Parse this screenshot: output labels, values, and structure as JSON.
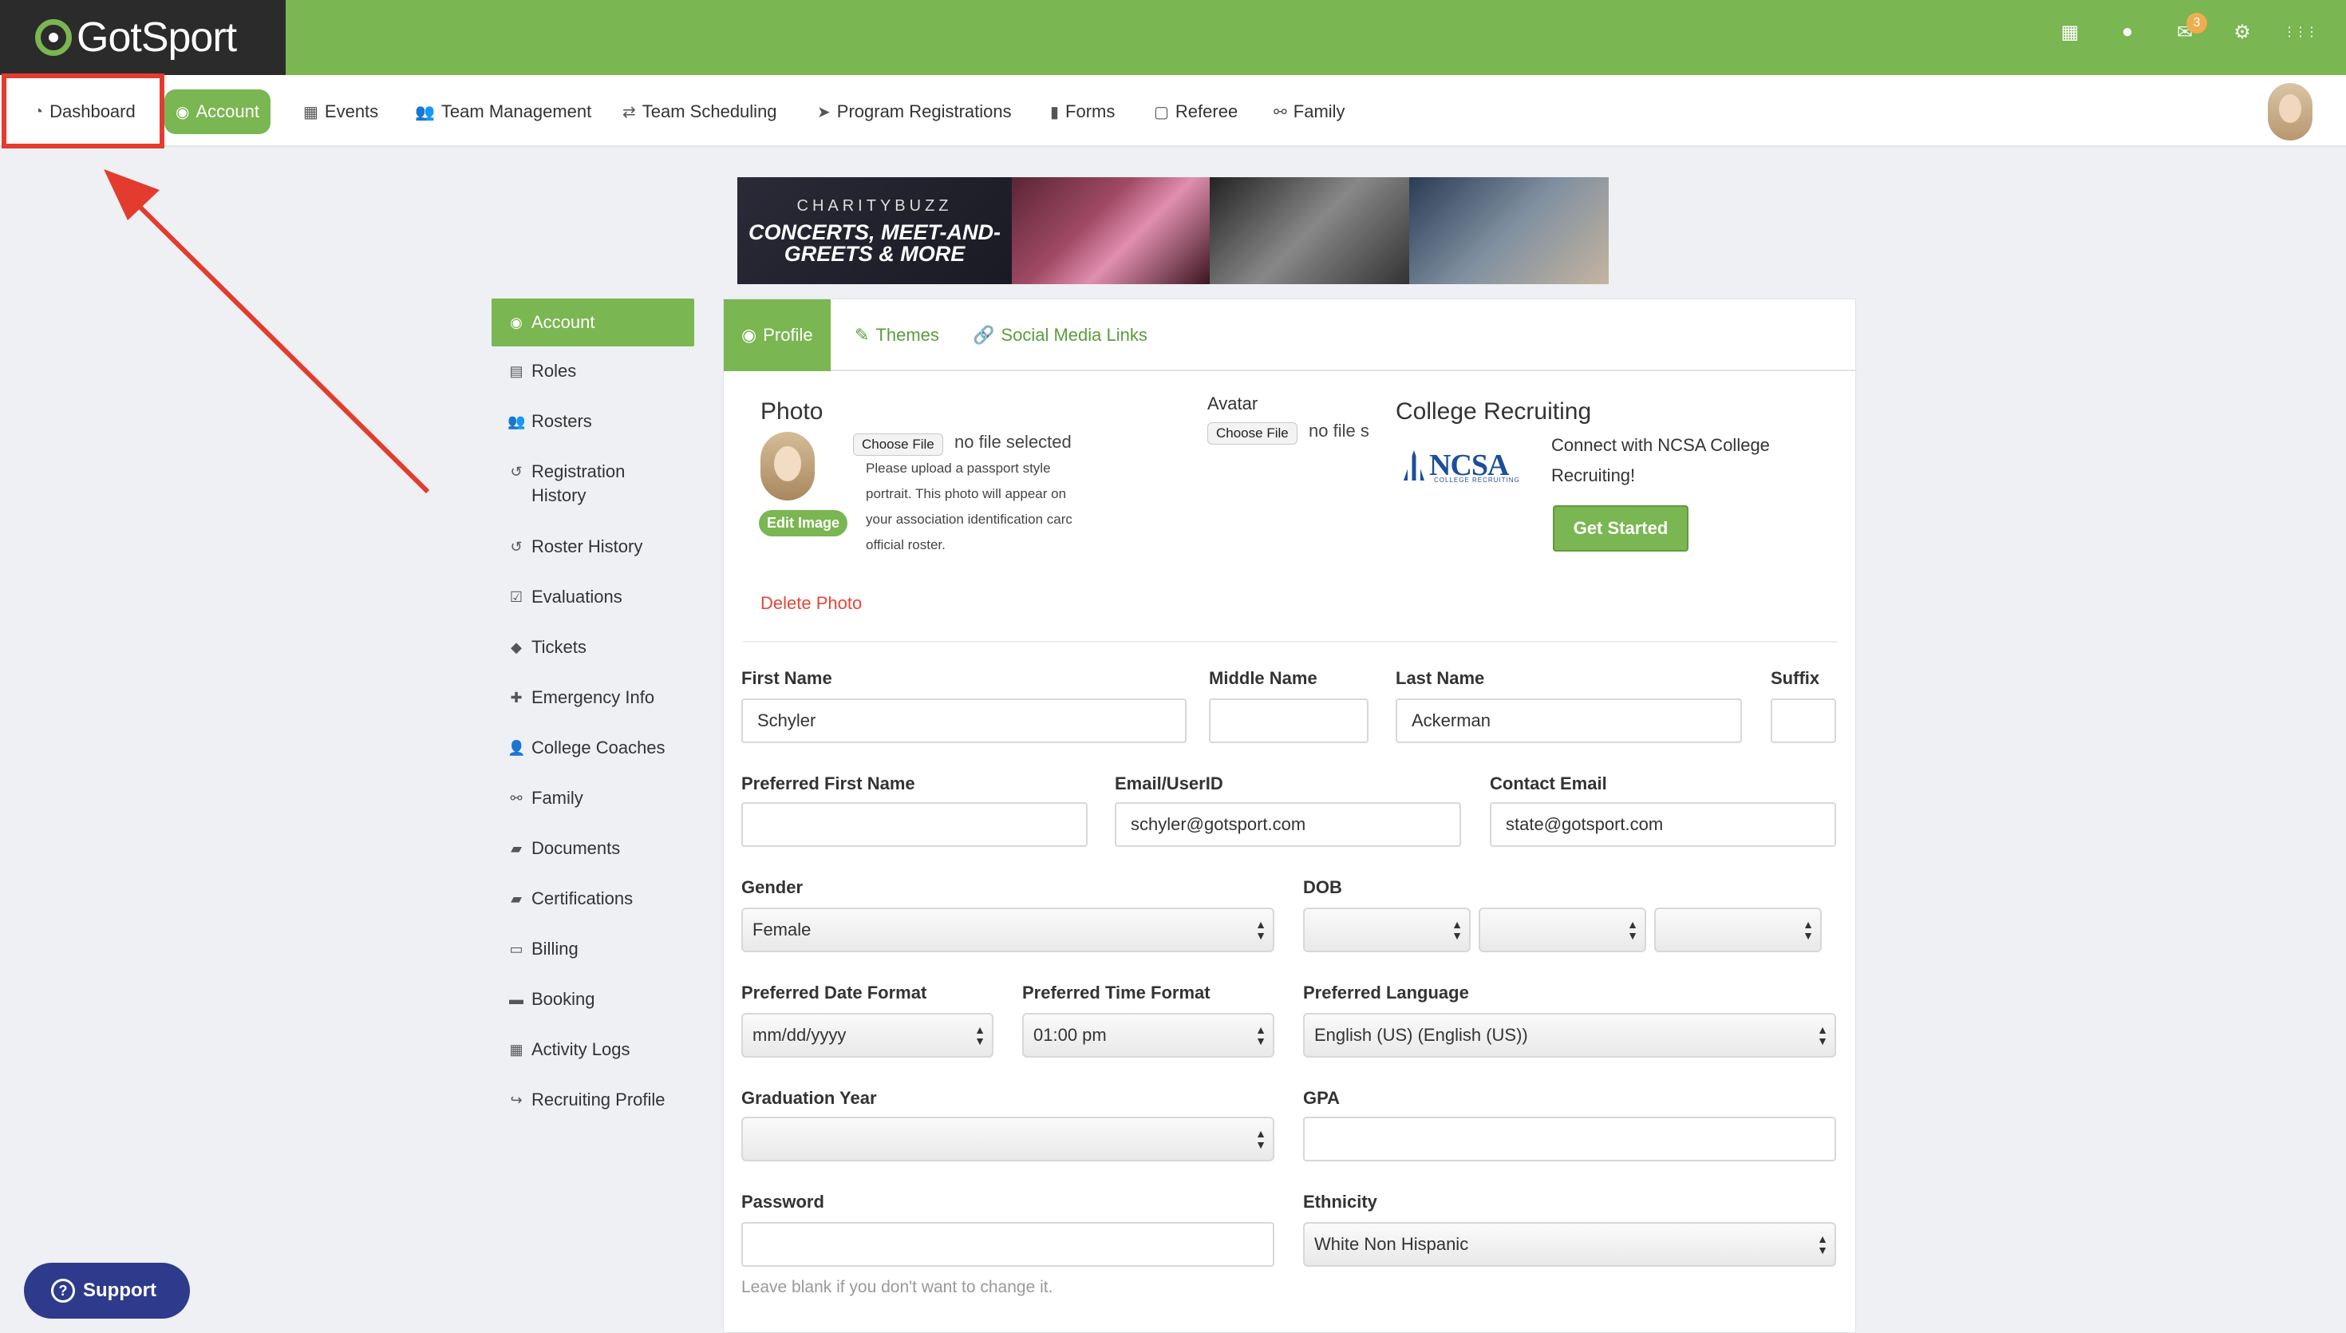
{
  "brand": {
    "logo_text": "GotSport",
    "accent": "#7ab651",
    "dark": "#2b2b2b"
  },
  "top_icons": {
    "qr": "▦",
    "user": "●",
    "mail": "✉",
    "mail_badge": "3",
    "gear": "⚙",
    "grid": "⋮⋮⋮"
  },
  "nav": {
    "dashboard": "Dashboard",
    "account": "Account",
    "events": "Events",
    "team_management": "Team Management",
    "team_scheduling": "Team Scheduling",
    "program_registrations": "Program Registrations",
    "forms": "Forms",
    "referee": "Referee",
    "family": "Family"
  },
  "banner": {
    "small": "CHARITYBUZZ",
    "big": "CONCERTS, MEET-AND-GREETS & MORE"
  },
  "sidebar": {
    "items": [
      {
        "label": "Account",
        "icon": "◉"
      },
      {
        "label": "Roles",
        "icon": "▤"
      },
      {
        "label": "Rosters",
        "icon": "👥"
      },
      {
        "label": "Registration History",
        "icon": "↺"
      },
      {
        "label": "Roster History",
        "icon": "↺"
      },
      {
        "label": "Evaluations",
        "icon": "☑"
      },
      {
        "label": "Tickets",
        "icon": "◆"
      },
      {
        "label": "Emergency Info",
        "icon": "✚"
      },
      {
        "label": "College Coaches",
        "icon": "👤"
      },
      {
        "label": "Family",
        "icon": "⚯"
      },
      {
        "label": "Documents",
        "icon": "▰"
      },
      {
        "label": "Certifications",
        "icon": "▰"
      },
      {
        "label": "Billing",
        "icon": "▭"
      },
      {
        "label": "Booking",
        "icon": "▬"
      },
      {
        "label": "Activity Logs",
        "icon": "▦"
      },
      {
        "label": "Recruiting Profile",
        "icon": "↪"
      }
    ]
  },
  "tabs": {
    "profile": "Profile",
    "themes": "Themes",
    "social": "Social Media Links"
  },
  "photo": {
    "title": "Photo",
    "choose_file": "Choose File",
    "no_file": "no file selected",
    "note_lines": [
      "Please upload a passport style",
      "portrait. This photo will appear on",
      "your association identification carc",
      "official roster."
    ],
    "edit_image": "Edit Image",
    "delete_photo": "Delete Photo"
  },
  "avatar": {
    "title": "Avatar",
    "choose_file": "Choose File",
    "no_file": "no file s"
  },
  "college": {
    "title": "College Recruiting",
    "ncsa": "NCSA",
    "ncsa_sub": "COLLEGE RECRUITING",
    "text_line1": "Connect with NCSA College",
    "text_line2": "Recruiting!",
    "button": "Get Started"
  },
  "form": {
    "first_name": {
      "label": "First Name",
      "value": "Schyler"
    },
    "middle_name": {
      "label": "Middle Name",
      "value": ""
    },
    "last_name": {
      "label": "Last Name",
      "value": "Ackerman"
    },
    "suffix": {
      "label": "Suffix",
      "value": ""
    },
    "preferred_first_name": {
      "label": "Preferred First Name",
      "value": ""
    },
    "email": {
      "label": "Email/UserID",
      "value": "schyler@gotsport.com"
    },
    "contact_email": {
      "label": "Contact Email",
      "value": "state@gotsport.com"
    },
    "gender": {
      "label": "Gender",
      "value": "Female"
    },
    "dob": {
      "label": "DOB",
      "month": "",
      "day": "",
      "year": ""
    },
    "date_format": {
      "label": "Preferred Date Format",
      "value": "mm/dd/yyyy"
    },
    "time_format": {
      "label": "Preferred Time Format",
      "value": "01:00 pm"
    },
    "language": {
      "label": "Preferred Language",
      "value": "English (US) (English (US))"
    },
    "graduation_year": {
      "label": "Graduation Year",
      "value": ""
    },
    "gpa": {
      "label": "GPA",
      "value": ""
    },
    "password": {
      "label": "Password",
      "value": "",
      "help": "Leave blank if you don't want to change it."
    },
    "ethnicity": {
      "label": "Ethnicity",
      "value": "White Non Hispanic"
    }
  },
  "support": {
    "label": "Support",
    "icon": "?"
  }
}
